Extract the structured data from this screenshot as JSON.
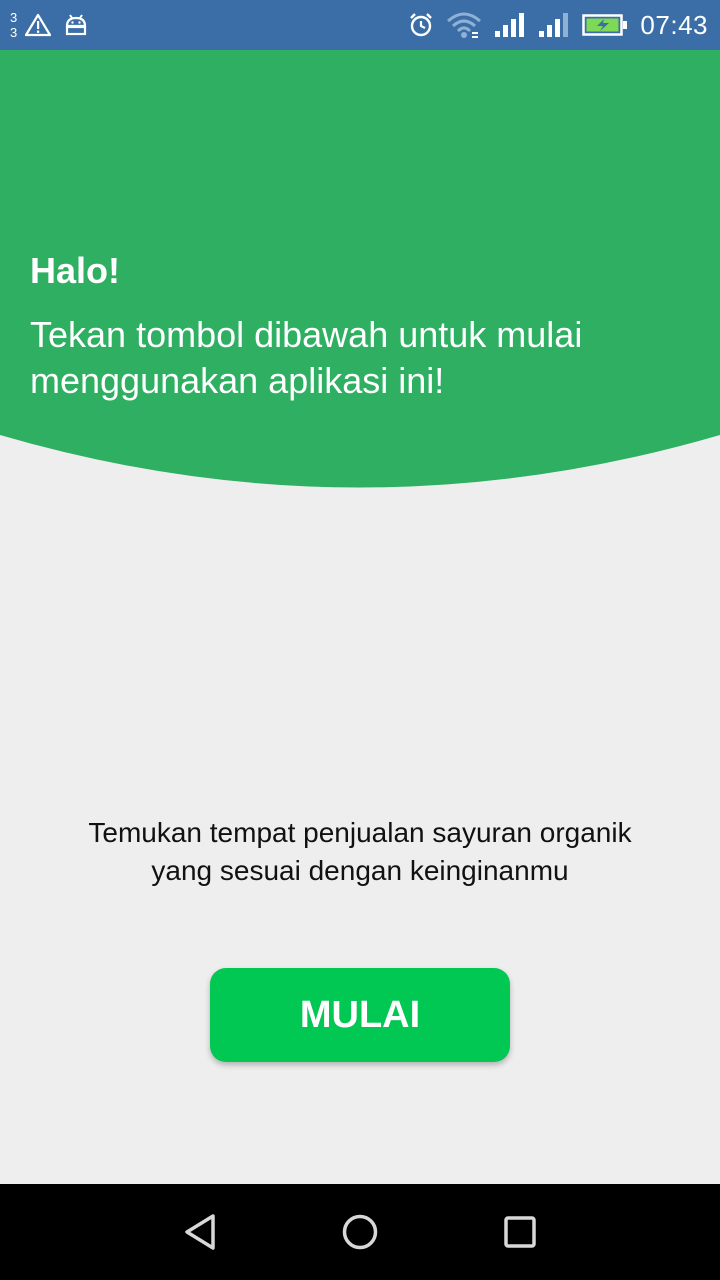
{
  "status_bar": {
    "notification_counts": [
      "3",
      "3"
    ],
    "icons": [
      "warning-icon",
      "android-icon",
      "alarm-icon",
      "wifi-icon",
      "signal-icon",
      "signal-icon",
      "battery-charging-icon"
    ],
    "time": "07:43",
    "background_color": "#3b6ea6"
  },
  "header": {
    "greeting": "Halo!",
    "subtitle": "Tekan tombol dibawah untuk mulai menggunakan aplikasi ini!",
    "background_color": "#2eaf62"
  },
  "main": {
    "description": "Temukan tempat penjualan sayuran organik yang sesuai dengan keinginanmu",
    "start_button_label": "MULAI",
    "button_color": "#00c853"
  },
  "nav_bar": {
    "icons": [
      "back-icon",
      "home-icon",
      "recents-icon"
    ]
  }
}
